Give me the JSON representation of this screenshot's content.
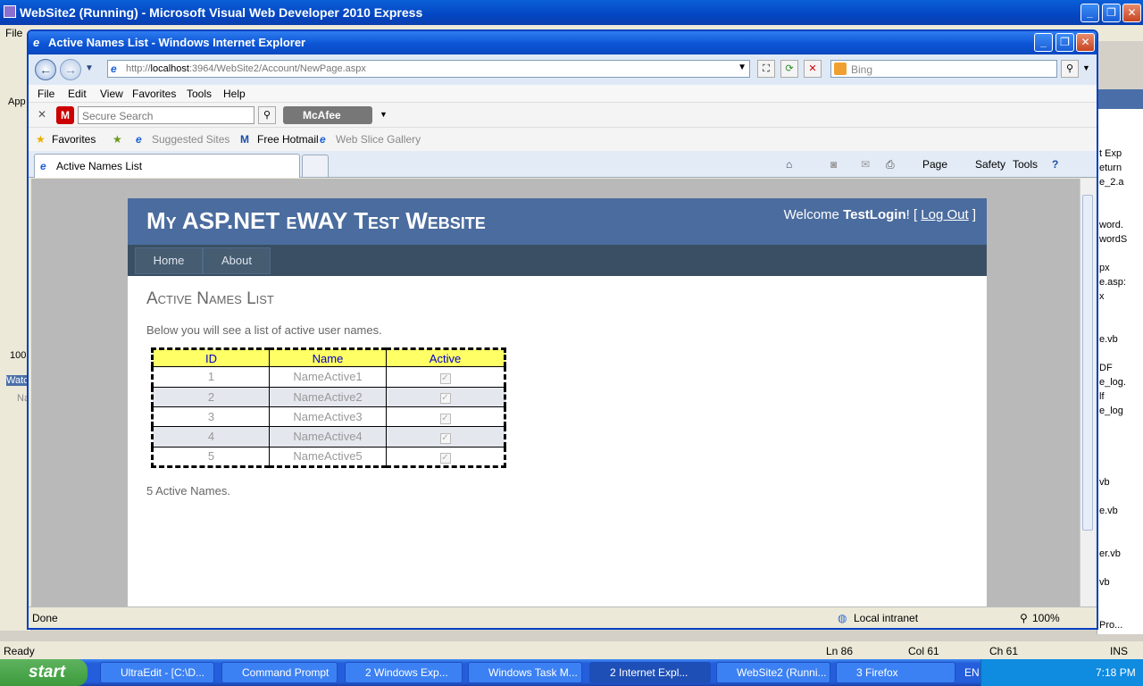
{
  "vs": {
    "title": "WebSite2 (Running) - Microsoft Visual Web Developer 2010 Express",
    "menu_file": "File",
    "left_number": "100",
    "left_watch": "Watc",
    "left_na": "Na",
    "left_app": "App",
    "right_lines": [
      "t Exp",
      "eturn",
      "e_2.a",
      "word.",
      "wordS",
      "px",
      "e.asp:",
      "x",
      "e.vb",
      "DF",
      "e_log.",
      "lf",
      "e_log",
      "vb",
      "e.vb",
      "er.vb",
      "vb",
      "Pro..."
    ],
    "status": {
      "ready": "Ready",
      "ln": "Ln 86",
      "col": "Col 61",
      "ch": "Ch 61",
      "ins": "INS"
    }
  },
  "ie": {
    "title": "Active Names List - Windows Internet Explorer",
    "url_host_prefix": "http://",
    "url_host": "localhost",
    "url_rest": ":3964/WebSite2/Account/NewPage.aspx",
    "search_placeholder": "Bing",
    "menu": [
      "File",
      "Edit",
      "View",
      "Favorites",
      "Tools",
      "Help"
    ],
    "mcafee": {
      "search_placeholder": "Secure Search",
      "brand": "McAfee"
    },
    "favorites": {
      "label": "Favorites",
      "suggested": "Suggested Sites",
      "hotmail": "Free Hotmail",
      "webslice": "Web Slice Gallery"
    },
    "tab_label": "Active Names List",
    "cmd": {
      "page": "Page",
      "safety": "Safety",
      "tools": "Tools"
    },
    "status": {
      "done": "Done",
      "zone": "Local intranet",
      "zoom": "100%"
    }
  },
  "site": {
    "title": "My ASP.NET eWAY Test Website",
    "welcome": "Welcome",
    "user": "TestLogin",
    "logout": "Log Out",
    "nav": [
      "Home",
      "About"
    ],
    "heading": "Active Names List",
    "intro": "Below you will see a list of active user names.",
    "grid": {
      "headers": [
        "ID",
        "Name",
        "Active"
      ],
      "rows": [
        {
          "id": "1",
          "name": "NameActive1",
          "active": true
        },
        {
          "id": "2",
          "name": "NameActive2",
          "active": true
        },
        {
          "id": "3",
          "name": "NameActive3",
          "active": true
        },
        {
          "id": "4",
          "name": "NameActive4",
          "active": true
        },
        {
          "id": "5",
          "name": "NameActive5",
          "active": true
        }
      ]
    },
    "count_text": "5 Active Names."
  },
  "taskbar": {
    "start": "start",
    "tasks": [
      "UltraEdit - [C:\\D...",
      "Command Prompt",
      "2 Windows Exp...",
      "Windows Task M...",
      "2 Internet Expl...",
      "WebSite2 (Runni...",
      "3 Firefox"
    ],
    "lang": "EN",
    "clock": "7:18 PM"
  }
}
